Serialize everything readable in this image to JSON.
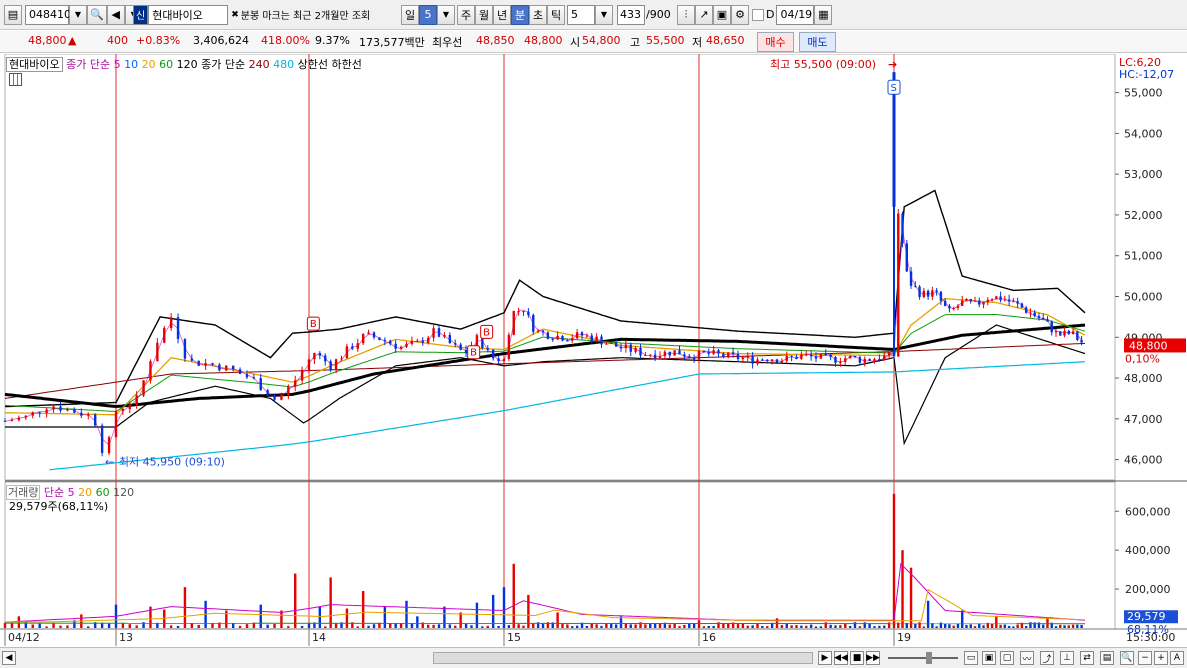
{
  "toolbar": {
    "code": "048410",
    "badge": "신",
    "name": "현대바이오",
    "notice": "분봉 마크는 최근 2개월만 조회",
    "period_day": "일",
    "period_num": "5",
    "period_week": "주",
    "period_month": "월",
    "period_year": "년",
    "period_min": "분",
    "period_sec": "초",
    "period_tick": "틱",
    "interval": "5",
    "count": "433",
    "count_total": "/900",
    "d_label": "D",
    "date": "04/19"
  },
  "info": {
    "price": "48,800",
    "arrow": "▲",
    "change": "400",
    "change_pct": "+0.83%",
    "volume": "3,406,624",
    "volume_ratio": "418.00%",
    "turnover": "9.37%",
    "amount": "173,577백만",
    "ask_label": "최우선",
    "ask": "48,850",
    "bid": "48,800",
    "open_label": "시",
    "open": "54,800",
    "high_label": "고",
    "high": "55,500",
    "low_label": "저",
    "low": "48,650",
    "buy": "매수",
    "sell": "매도"
  },
  "legend": {
    "stock": "현대바이오",
    "price_type": "종가 단순",
    "ma5": "5",
    "ma10": "10",
    "ma20": "20",
    "ma60": "60",
    "ma120": "120",
    "price_type2": "종가 단순",
    "ma240": "240",
    "ma480": "480",
    "upper": "상한선",
    "lower": "하한선",
    "vol_label": "거래량",
    "vol_type": "단순",
    "vol5": "5",
    "vol20": "20",
    "vol60": "60",
    "vol120": "120",
    "vol_value": "29,579주(68,11%)"
  },
  "colors": {
    "up": "#e60000",
    "down": "#0033dd",
    "ma5": "#cc00cc",
    "ma10": "#0066ff",
    "ma20": "#e8a000",
    "ma60": "#119911",
    "ma120": "#000000",
    "ma240": "#8b0000",
    "ma480": "#00b8e0",
    "day_line": "#e23030"
  },
  "chart_data": {
    "type": "candlestick",
    "x_labels": [
      "04/12",
      "13",
      "14",
      "15",
      "16",
      "19"
    ],
    "y_ticks": [
      46000,
      47000,
      48000,
      49000,
      50000,
      51000,
      52000,
      53000,
      54000,
      55000
    ],
    "y_tick_labels": [
      "46,000",
      "47,000",
      "48,000",
      "49,000",
      "50,000",
      "51,000",
      "52,000",
      "53,000",
      "54,000",
      "55,000"
    ],
    "ylim": [
      45500,
      55800
    ],
    "vol_ticks": [
      200000,
      400000,
      600000
    ],
    "vol_tick_labels": [
      "200,000",
      "400,000",
      "600,000"
    ],
    "vol_ylim": [
      0,
      730000
    ],
    "time_label": "15:30:00",
    "lc": "LC:6,20",
    "hc": "HC:-12,07",
    "current_price": "48,800",
    "current_price_value": 48800,
    "current_pct": "0,10%",
    "vol_current": "29,579",
    "vol_current_value": 29579,
    "vol_pct": "68,11%",
    "high_note": "최고 55,500 (09:00)",
    "high_value": 55500,
    "low_note": "최저 45,950 (09:10)",
    "low_value": 45950,
    "sell_marker": "S",
    "buy_marker": "B",
    "price_path": [
      [
        0,
        46950
      ],
      [
        0.04,
        47050
      ],
      [
        0.08,
        47350
      ],
      [
        0.12,
        47200
      ],
      [
        0.16,
        47050
      ],
      [
        0.18,
        46000
      ],
      [
        0.2,
        47200
      ],
      [
        0.24,
        47500
      ],
      [
        0.27,
        48800
      ],
      [
        0.3,
        49500
      ],
      [
        0.33,
        48400
      ],
      [
        0.37,
        48350
      ],
      [
        0.41,
        48200
      ],
      [
        0.45,
        47950
      ],
      [
        0.49,
        47450
      ],
      [
        0.52,
        47850
      ],
      [
        0.56,
        48650
      ],
      [
        0.6,
        48300
      ],
      [
        0.64,
        48700
      ],
      [
        0.68,
        49050
      ],
      [
        0.72,
        48950
      ],
      [
        0.76,
        48750
      ],
      [
        0.8,
        48850
      ],
      [
        0.84,
        49150
      ],
      [
        0.88,
        48800
      ],
      [
        0.91,
        48600
      ],
      [
        0.94,
        49000
      ],
      [
        0.97,
        48500
      ],
      [
        1.0,
        48450
      ],
      [
        1.02,
        49600
      ],
      [
        1.05,
        49700
      ],
      [
        1.08,
        49150
      ],
      [
        1.12,
        49050
      ],
      [
        1.16,
        49000
      ],
      [
        1.2,
        49050
      ],
      [
        1.24,
        48950
      ],
      [
        1.28,
        48800
      ],
      [
        1.32,
        48700
      ],
      [
        1.36,
        48600
      ],
      [
        1.4,
        48600
      ],
      [
        1.44,
        48650
      ],
      [
        1.48,
        48550
      ],
      [
        1.52,
        48600
      ],
      [
        1.56,
        48550
      ],
      [
        1.6,
        48500
      ],
      [
        1.64,
        48450
      ],
      [
        1.68,
        48500
      ],
      [
        1.72,
        48450
      ],
      [
        1.76,
        48550
      ],
      [
        1.8,
        48500
      ],
      [
        1.84,
        48450
      ],
      [
        1.88,
        48500
      ],
      [
        1.92,
        48450
      ],
      [
        1.96,
        48500
      ],
      [
        2.0,
        48550
      ],
      [
        2.005,
        54800
      ],
      [
        2.01,
        52200
      ],
      [
        2.04,
        50400
      ],
      [
        2.08,
        50050
      ],
      [
        2.12,
        50100
      ],
      [
        2.16,
        49600
      ],
      [
        2.2,
        49850
      ],
      [
        2.24,
        49800
      ],
      [
        2.28,
        50000
      ],
      [
        2.32,
        49950
      ],
      [
        2.36,
        49800
      ],
      [
        2.4,
        49600
      ],
      [
        2.44,
        49400
      ],
      [
        2.48,
        49050
      ],
      [
        2.52,
        49100
      ],
      [
        2.56,
        48800
      ]
    ],
    "ma_path_20": [
      [
        0,
        47150
      ],
      [
        0.2,
        47100
      ],
      [
        0.3,
        48500
      ],
      [
        0.45,
        48100
      ],
      [
        0.52,
        47900
      ],
      [
        0.6,
        48300
      ],
      [
        0.75,
        48950
      ],
      [
        0.9,
        48750
      ],
      [
        1.0,
        48700
      ],
      [
        1.1,
        49200
      ],
      [
        1.3,
        48800
      ],
      [
        1.6,
        48600
      ],
      [
        2.0,
        48550
      ],
      [
        2.05,
        49300
      ],
      [
        2.15,
        49950
      ],
      [
        2.3,
        49850
      ],
      [
        2.45,
        49550
      ],
      [
        2.56,
        49050
      ]
    ],
    "ma_path_120": [
      [
        0,
        47600
      ],
      [
        0.2,
        47300
      ],
      [
        0.35,
        47500
      ],
      [
        0.52,
        47600
      ],
      [
        0.7,
        48100
      ],
      [
        1.0,
        48600
      ],
      [
        1.3,
        48950
      ],
      [
        1.6,
        48900
      ],
      [
        1.9,
        48750
      ],
      [
        2.0,
        48700
      ],
      [
        2.2,
        49050
      ],
      [
        2.56,
        49300
      ]
    ],
    "ma_path_480": [
      [
        0.08,
        45750
      ],
      [
        0.5,
        46350
      ],
      [
        1.0,
        47200
      ],
      [
        1.5,
        48100
      ],
      [
        2.0,
        48150
      ],
      [
        2.56,
        48400
      ]
    ],
    "ma_path_240": [
      [
        0,
        47500
      ],
      [
        0.3,
        48100
      ],
      [
        0.6,
        48200
      ],
      [
        1.0,
        48350
      ],
      [
        1.5,
        48500
      ],
      [
        2.0,
        48650
      ],
      [
        2.56,
        48850
      ]
    ],
    "upper_path": [
      [
        0,
        47300
      ],
      [
        0.2,
        47400
      ],
      [
        0.28,
        49500
      ],
      [
        0.38,
        49300
      ],
      [
        0.48,
        48500
      ],
      [
        0.52,
        49100
      ],
      [
        0.62,
        49200
      ],
      [
        0.75,
        49500
      ],
      [
        0.9,
        49200
      ],
      [
        1.0,
        49600
      ],
      [
        1.04,
        50400
      ],
      [
        1.1,
        50000
      ],
      [
        1.3,
        49400
      ],
      [
        1.6,
        49150
      ],
      [
        1.9,
        49000
      ],
      [
        2.0,
        49100
      ],
      [
        2.03,
        52200
      ],
      [
        2.12,
        52600
      ],
      [
        2.2,
        50500
      ],
      [
        2.35,
        50150
      ],
      [
        2.48,
        50200
      ],
      [
        2.56,
        49600
      ]
    ],
    "lower_path": [
      [
        0,
        46800
      ],
      [
        0.2,
        46800
      ],
      [
        0.26,
        47400
      ],
      [
        0.38,
        47800
      ],
      [
        0.48,
        47500
      ],
      [
        0.54,
        46900
      ],
      [
        0.62,
        47500
      ],
      [
        0.75,
        48300
      ],
      [
        0.9,
        48500
      ],
      [
        1.0,
        48300
      ],
      [
        1.1,
        48400
      ],
      [
        1.3,
        48500
      ],
      [
        1.6,
        48400
      ],
      [
        1.9,
        48300
      ],
      [
        2.0,
        48500
      ],
      [
        2.03,
        46400
      ],
      [
        2.15,
        48500
      ],
      [
        2.3,
        49300
      ],
      [
        2.56,
        48600
      ]
    ],
    "volume_spikes": [
      [
        0.03,
        60000
      ],
      [
        0.12,
        40000
      ],
      [
        0.14,
        70000
      ],
      [
        0.16,
        30000
      ],
      [
        0.2,
        120000
      ],
      [
        0.26,
        110000
      ],
      [
        0.29,
        95000
      ],
      [
        0.32,
        210000
      ],
      [
        0.36,
        140000
      ],
      [
        0.4,
        90000
      ],
      [
        0.46,
        120000
      ],
      [
        0.5,
        90000
      ],
      [
        0.52,
        280000
      ],
      [
        0.57,
        110000
      ],
      [
        0.6,
        260000
      ],
      [
        0.64,
        100000
      ],
      [
        0.68,
        190000
      ],
      [
        0.72,
        110000
      ],
      [
        0.77,
        140000
      ],
      [
        0.8,
        60000
      ],
      [
        0.86,
        110000
      ],
      [
        0.9,
        80000
      ],
      [
        0.94,
        130000
      ],
      [
        0.98,
        170000
      ],
      [
        1.0,
        210000
      ],
      [
        1.02,
        330000
      ],
      [
        1.06,
        170000
      ],
      [
        1.14,
        80000
      ],
      [
        1.3,
        60000
      ],
      [
        1.5,
        40000
      ],
      [
        1.7,
        50000
      ],
      [
        1.9,
        30000
      ],
      [
        2.0,
        690000
      ],
      [
        2.02,
        400000
      ],
      [
        2.05,
        310000
      ],
      [
        2.1,
        140000
      ],
      [
        2.2,
        90000
      ],
      [
        2.3,
        60000
      ],
      [
        2.45,
        50000
      ],
      [
        2.56,
        30000
      ]
    ],
    "vol_ma_path": [
      [
        0,
        30000
      ],
      [
        0.2,
        60000
      ],
      [
        0.3,
        110000
      ],
      [
        0.5,
        80000
      ],
      [
        0.6,
        120000
      ],
      [
        1.0,
        90000
      ],
      [
        1.05,
        140000
      ],
      [
        1.2,
        70000
      ],
      [
        1.6,
        40000
      ],
      [
        2.0,
        40000
      ],
      [
        2.02,
        330000
      ],
      [
        2.06,
        260000
      ],
      [
        2.15,
        90000
      ],
      [
        2.56,
        40000
      ]
    ]
  },
  "status": {
    "scroll_zoom": "▶◀"
  }
}
